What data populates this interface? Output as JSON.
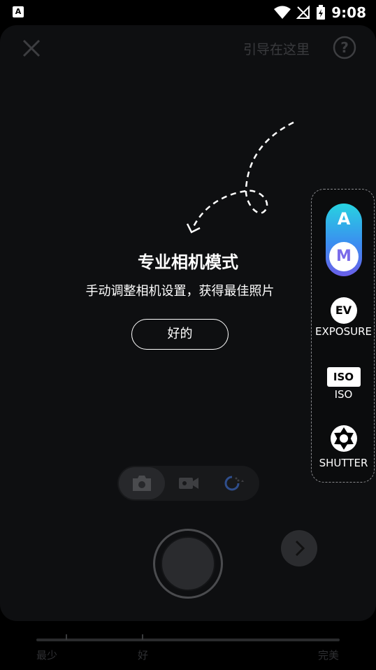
{
  "status_bar": {
    "left_icon_letter": "A",
    "time": "9:08"
  },
  "header": {
    "close_icon": "close-icon",
    "guide_link": "引导在这里",
    "help_icon": "help-icon"
  },
  "guide": {
    "title": "专业相机模式",
    "subtitle": "手动调整相机设置，获得最佳照片",
    "ok_label": "好的"
  },
  "pro_panel": {
    "mode_auto": "A",
    "mode_manual": "M",
    "ev_badge": "EV",
    "exposure_label": "EXPOSURE",
    "iso_badge": "ISO",
    "iso_label": "ISO",
    "shutter_label": "SHUTTER"
  },
  "mode_bar": {
    "items": [
      "photo-icon",
      "video-icon",
      "timer-icon"
    ],
    "selected": 0
  },
  "quality": {
    "labels": [
      "最少",
      "好",
      "完美"
    ]
  },
  "colors": {
    "accent_top": "#27d3e0",
    "accent_bottom": "#6a5fe8",
    "background": "#0e0f11"
  }
}
